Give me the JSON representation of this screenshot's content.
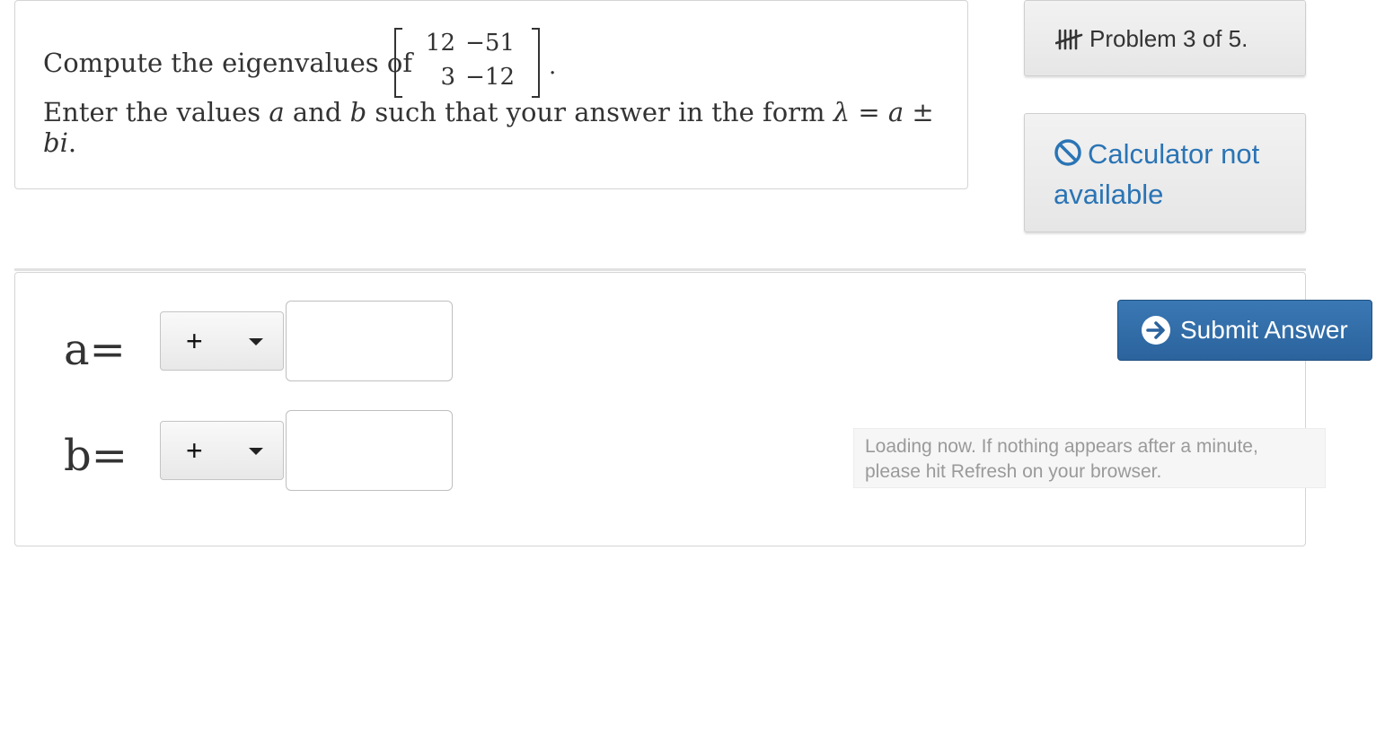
{
  "question": {
    "prefix": "Compute the eigenvalues of",
    "matrix": [
      [
        "12",
        "−51"
      ],
      [
        "3",
        "−12"
      ]
    ],
    "period": ".",
    "line2_part1": "Enter the values ",
    "var_a": "a",
    "line2_and": " and ",
    "var_b": "b",
    "line2_part2": " such that your answer in the form ",
    "formula_lambda": "λ",
    "formula_eq": " = ",
    "formula_a": "a",
    "formula_pm": " ± ",
    "formula_bi": "bi",
    "formula_end": "."
  },
  "problem_indicator": {
    "icon": "tally-marks-icon",
    "label": "Problem 3 of 5."
  },
  "calculator": {
    "icon": "ban-icon",
    "label": "Calculator not available"
  },
  "answers": {
    "a": {
      "label": "a=",
      "sign": "+",
      "value": ""
    },
    "b": {
      "label": "b=",
      "sign": "+",
      "value": ""
    }
  },
  "submit": {
    "icon": "arrow-circle-right-icon",
    "label": "Submit Answer"
  },
  "loading_notice": "Loading now.  If nothing appears after a minute, please hit Refresh on your browser.",
  "colors": {
    "accent_blue": "#2a74b5",
    "submit_bg": "#2b639d",
    "text": "#333333",
    "muted": "#9a9a9a"
  }
}
